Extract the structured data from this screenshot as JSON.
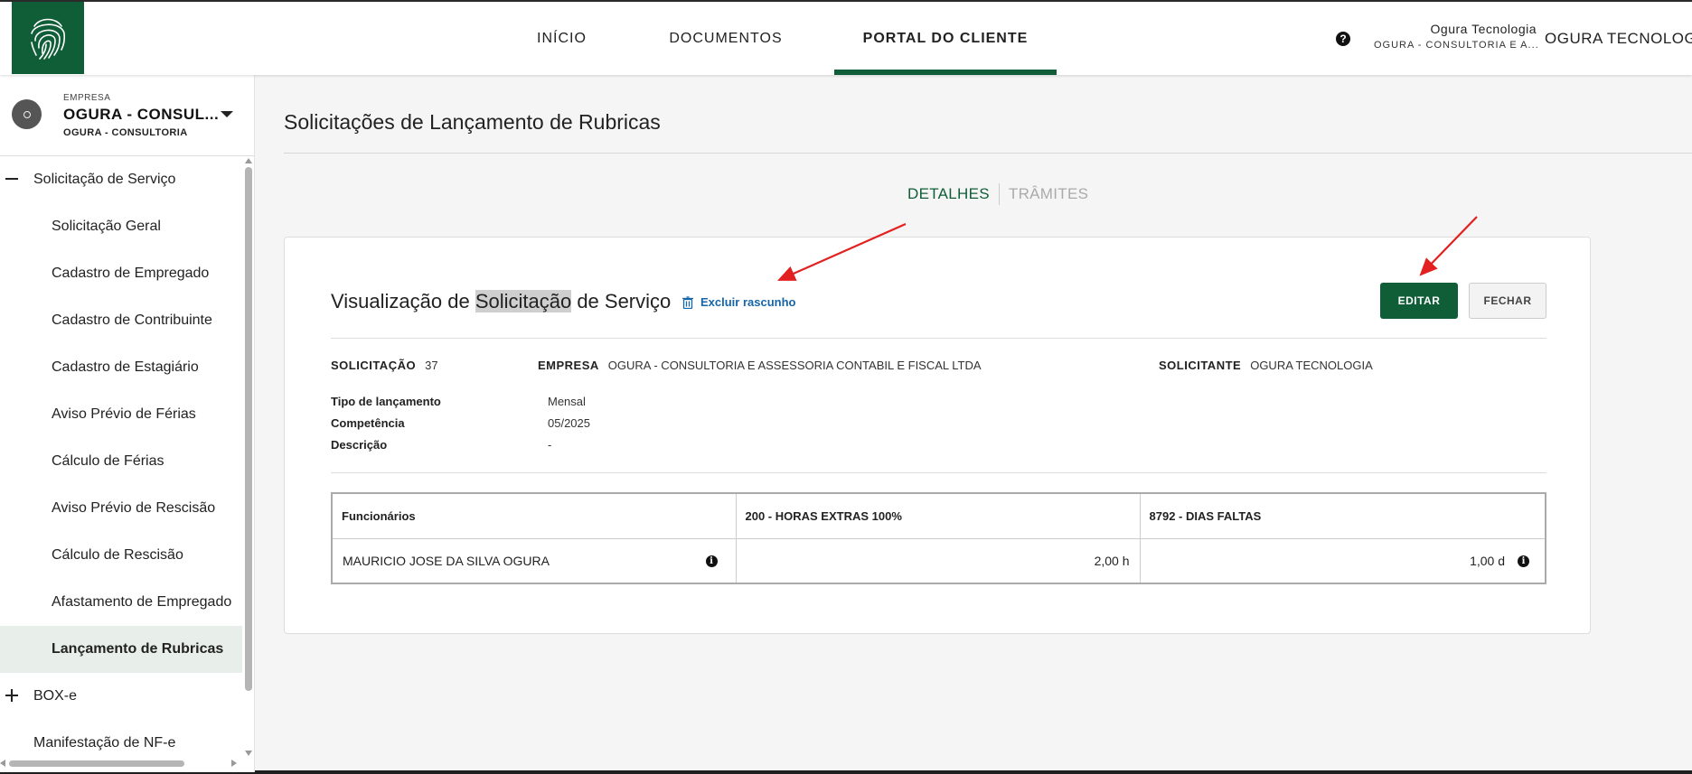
{
  "header": {
    "nav": [
      "INÍCIO",
      "DOCUMENTOS",
      "PORTAL DO CLIENTE"
    ],
    "help_icon": "?",
    "user_name": "Ogura Tecnologia",
    "user_company": "OGURA - CONSULTORIA E A...",
    "org_name": "OGURA TECNOLOGIA",
    "brand_color": "#0f5e37"
  },
  "sidebar": {
    "company_label": "EMPRESA",
    "company_name": "OGURA - CONSUL...",
    "company_sub": "OGURA - CONSULTORIA",
    "items": [
      {
        "label": "Solicitação de Serviço",
        "type": "group",
        "toggle": "minus"
      },
      {
        "label": "Solicitação Geral",
        "type": "sub"
      },
      {
        "label": "Cadastro de Empregado",
        "type": "sub"
      },
      {
        "label": "Cadastro de Contribuinte",
        "type": "sub"
      },
      {
        "label": "Cadastro de Estagiário",
        "type": "sub"
      },
      {
        "label": "Aviso Prévio de Férias",
        "type": "sub"
      },
      {
        "label": "Cálculo de Férias",
        "type": "sub"
      },
      {
        "label": "Aviso Prévio de Rescisão",
        "type": "sub"
      },
      {
        "label": "Cálculo de Rescisão",
        "type": "sub"
      },
      {
        "label": "Afastamento de Empregado",
        "type": "sub"
      },
      {
        "label": "Lançamento de Rubricas",
        "type": "sub",
        "active": true
      },
      {
        "label": "BOX-e",
        "type": "group",
        "toggle": "plus"
      },
      {
        "label": "Manifestação de NF-e",
        "type": "group"
      }
    ]
  },
  "main": {
    "page_title": "Solicitações de Lançamento de Rubricas",
    "tabs": {
      "active": "DETALHES",
      "inactive": "TRÂMITES"
    },
    "card": {
      "title_before": "Visualização de ",
      "title_highlight": "Solicitação",
      "title_after": " de Serviço",
      "delete_link": "Excluir rascunho",
      "edit_button": "EDITAR",
      "close_button": "FECHAR",
      "solicitacao_label": "SOLICITAÇÃO",
      "solicitacao_value": "37",
      "empresa_label": "EMPRESA",
      "empresa_value": "OGURA - CONSULTORIA E ASSESSORIA CONTABIL E FISCAL LTDA",
      "solicitante_label": "SOLICITANTE",
      "solicitante_value": "OGURA TECNOLOGIA",
      "fields": [
        {
          "label": "Tipo de lançamento",
          "value": "Mensal"
        },
        {
          "label": "Competência",
          "value": "05/2025"
        },
        {
          "label": "Descrição",
          "value": "-"
        }
      ],
      "table": {
        "headers": [
          "Funcionários",
          "200 - HORAS EXTRAS 100%",
          "8792 - DIAS FALTAS"
        ],
        "rows": [
          {
            "name": "MAURICIO JOSE DA SILVA OGURA",
            "horas": "2,00 h",
            "faltas": "1,00 d"
          }
        ]
      }
    }
  }
}
